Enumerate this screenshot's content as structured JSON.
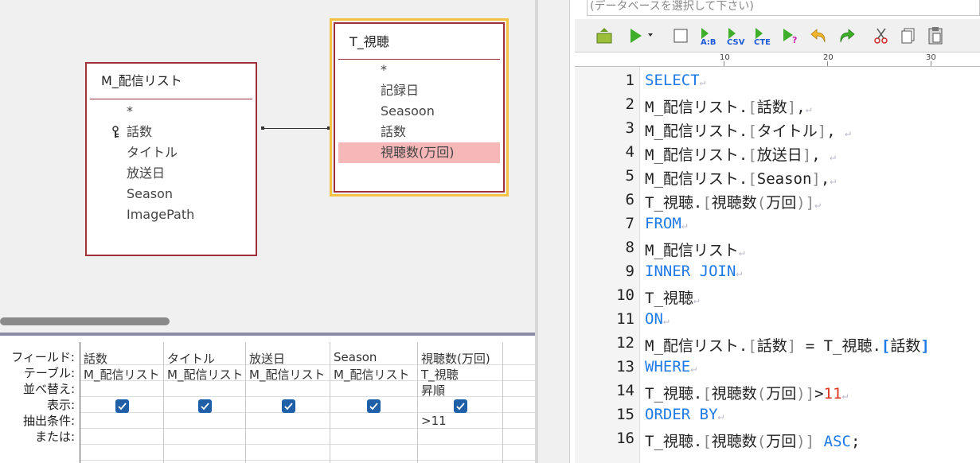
{
  "designer": {
    "tables": {
      "m": {
        "title": "M_配信リスト",
        "fields": [
          "*",
          "話数",
          "タイトル",
          "放送日",
          "Season",
          "ImagePath"
        ]
      },
      "t": {
        "title": "T_視聴",
        "fields": [
          "*",
          "記録日",
          "Seasoon",
          "話数",
          "視聴数(万回)"
        ],
        "selected": "視聴数(万回)"
      }
    },
    "grid": {
      "row_labels": [
        "フィールド:",
        "テーブル:",
        "並べ替え:",
        "表示:",
        "抽出条件:",
        "または:"
      ],
      "columns": [
        {
          "field": "話数",
          "table": "M_配信リスト",
          "sort": "",
          "show": true,
          "criteria": ""
        },
        {
          "field": "タイトル",
          "table": "M_配信リスト",
          "sort": "",
          "show": true,
          "criteria": ""
        },
        {
          "field": "放送日",
          "table": "M_配信リスト",
          "sort": "",
          "show": true,
          "criteria": ""
        },
        {
          "field": "Season",
          "table": "M_配信リスト",
          "sort": "",
          "show": true,
          "criteria": ""
        },
        {
          "field": "視聴数(万回)",
          "table": "T_視聴",
          "sort": "昇順",
          "show": true,
          "criteria": ">11"
        }
      ]
    }
  },
  "editor": {
    "db_select_placeholder": "(データベースを選択して下さい)",
    "toolbar_icons": [
      "open-db-icon",
      "run-dropdown-icon",
      "stop-icon",
      "format-ab-icon",
      "csv-icon",
      "cte-icon",
      "explain-icon",
      "undo-icon",
      "redo-icon",
      "cut-icon",
      "copy-icon",
      "paste-icon"
    ],
    "ruler_labels": [
      "10",
      "20",
      "30"
    ],
    "code_lines": [
      "1",
      "2",
      "3",
      "4",
      "5",
      "6",
      "7",
      "8",
      "9",
      "10",
      "11",
      "12",
      "13",
      "14",
      "15",
      "16"
    ]
  },
  "colors": {
    "keyword": "#1e7ae6",
    "number": "#e0321e",
    "table_border": "#a0303a",
    "selected_field": "#f6b7b9",
    "active_table_highlight": "#f5c242"
  }
}
